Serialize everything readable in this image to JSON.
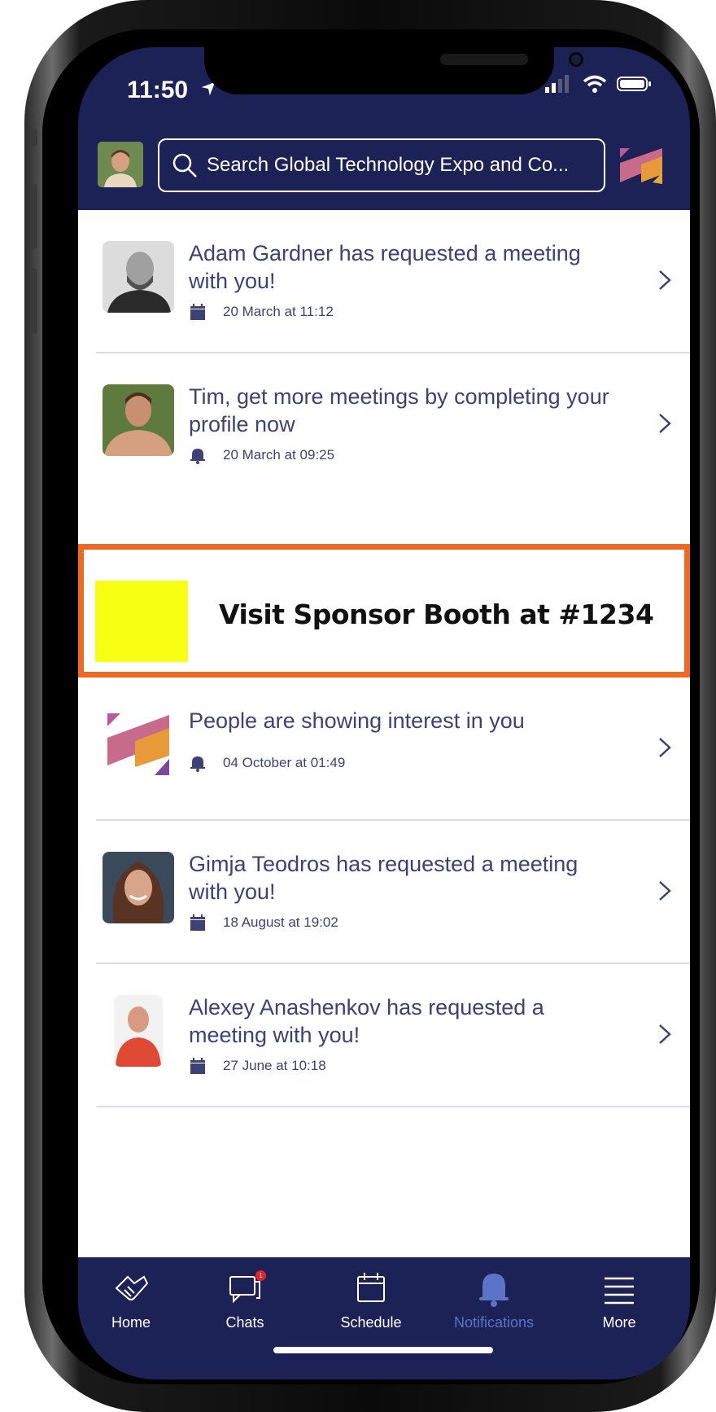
{
  "status_bar": {
    "time": "11:50"
  },
  "header": {
    "search_placeholder": "Search Global Technology Expo and Co..."
  },
  "notifications": [
    {
      "title": "Adam Gardner has requested a meeting with you!",
      "icon": "calendar-icon",
      "date": "20 March at 11:12"
    },
    {
      "title": "Tim, get more meetings by completing your profile now",
      "icon": "bell-icon",
      "date": "20 March at 09:25"
    },
    {
      "title": "People are showing interest in you",
      "icon": "bell-icon",
      "date": "04 October at 01:49"
    },
    {
      "title": "Gimja Teodros has requested a meeting with you!",
      "icon": "calendar-icon",
      "date": "18 August at 19:02"
    },
    {
      "title": "Alexey Anashenkov has requested a meeting with you!",
      "icon": "calendar-icon",
      "date": "27 June at 10:18"
    }
  ],
  "sponsor": {
    "label": "Visit Sponsor Booth at #1234",
    "swatch_color": "#f7ff12",
    "border_color": "#ee6a24"
  },
  "tabs": [
    {
      "label": "Home",
      "icon": "handshake-icon"
    },
    {
      "label": "Chats",
      "icon": "chat-icon",
      "badge": "1"
    },
    {
      "label": "Schedule",
      "icon": "calendar-icon"
    },
    {
      "label": "Notifications",
      "icon": "bell-icon",
      "active": true
    },
    {
      "label": "More",
      "icon": "menu-icon"
    }
  ],
  "colors": {
    "nav_bg": "#1c2255",
    "text": "#3d4176",
    "active_tab": "#5a74c8"
  }
}
